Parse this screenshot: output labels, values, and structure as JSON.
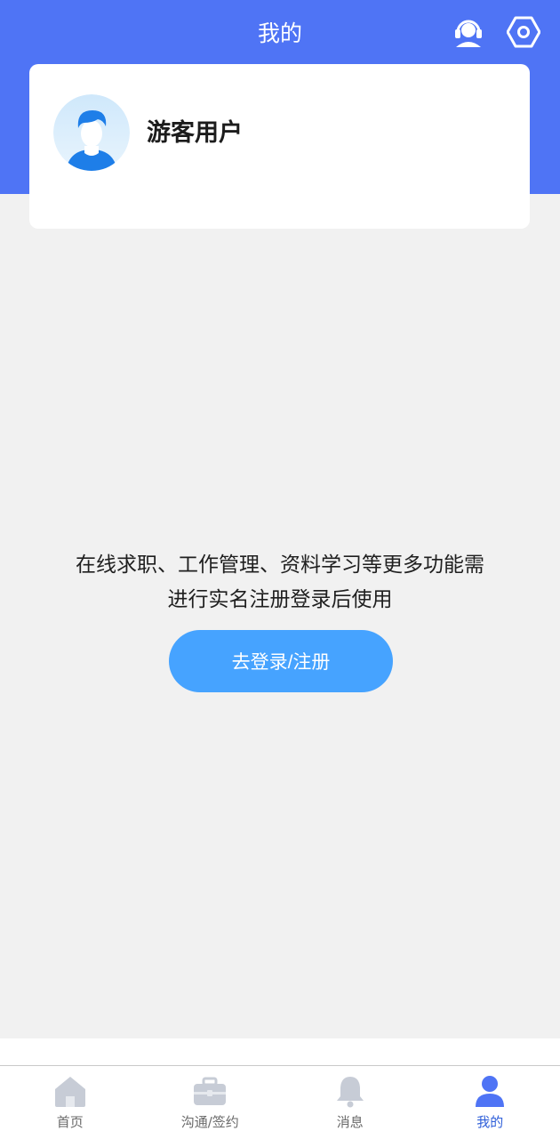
{
  "header": {
    "title": "我的",
    "background": "#4f74f5",
    "support_icon": "customer-service-icon",
    "settings_icon": "settings-hexagon-icon"
  },
  "profile": {
    "username": "游客用户",
    "avatar_icon": "user-avatar-icon"
  },
  "prompt": {
    "line1": "在线求职、工作管理、资料学习等更多功能需",
    "line2": "进行实名注册登录后使用"
  },
  "login_button": {
    "label": "去登录/注册",
    "color": "#46a3ff"
  },
  "tabbar": {
    "items": [
      {
        "label": "首页",
        "icon": "home-icon",
        "active": false
      },
      {
        "label": "沟通/签约",
        "icon": "briefcase-icon",
        "active": false
      },
      {
        "label": "消息",
        "icon": "bell-icon",
        "active": false
      },
      {
        "label": "我的",
        "icon": "user-icon",
        "active": true
      }
    ],
    "active_color": "#2f5fd9"
  }
}
